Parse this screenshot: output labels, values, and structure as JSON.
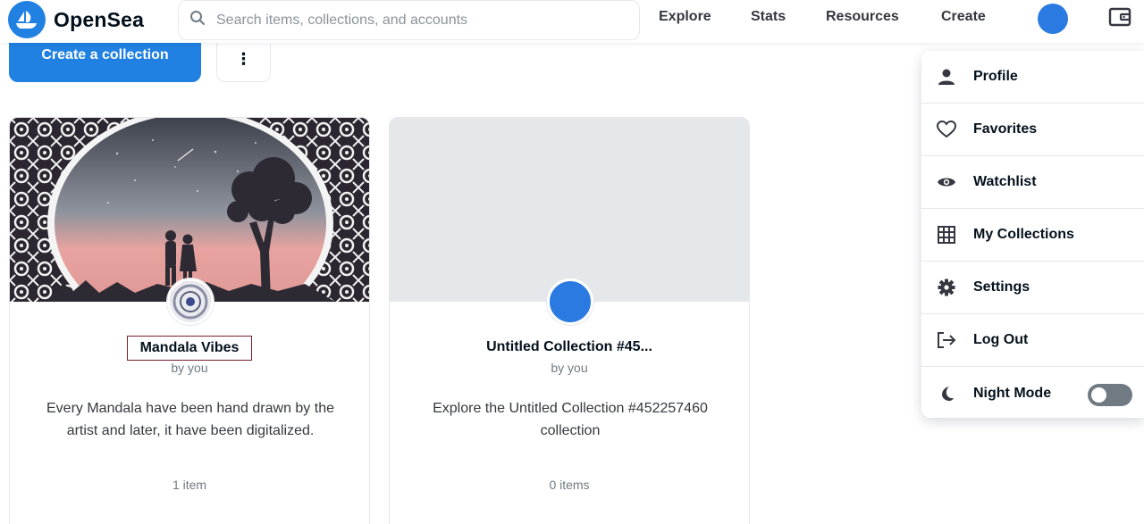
{
  "brand": {
    "name": "OpenSea",
    "accent": "#2081e2"
  },
  "search": {
    "placeholder": "Search items, collections, and accounts",
    "value": ""
  },
  "nav": {
    "links": [
      "Explore",
      "Stats",
      "Resources",
      "Create"
    ]
  },
  "actions": {
    "create_label": "Create a collection",
    "more_label": "⋮"
  },
  "collections": [
    {
      "name": "Mandala Vibes",
      "by": "by you",
      "description": "Every Mandala have been hand drawn by the artist and later, it have been digitalized.",
      "items": "1 item"
    },
    {
      "name": "Untitled Collection #45...",
      "by": "by you",
      "description": "Explore the Untitled Collection #452257460 collection",
      "items": "0 items"
    }
  ],
  "menu": {
    "items": [
      {
        "label": "Profile",
        "icon": "person-icon"
      },
      {
        "label": "Favorites",
        "icon": "heart-icon"
      },
      {
        "label": "Watchlist",
        "icon": "eye-icon"
      },
      {
        "label": "My Collections",
        "icon": "grid-icon"
      },
      {
        "label": "Settings",
        "icon": "gear-icon"
      },
      {
        "label": "Log Out",
        "icon": "logout-icon"
      },
      {
        "label": "Night Mode",
        "icon": "moon-icon",
        "toggle": false
      }
    ]
  }
}
